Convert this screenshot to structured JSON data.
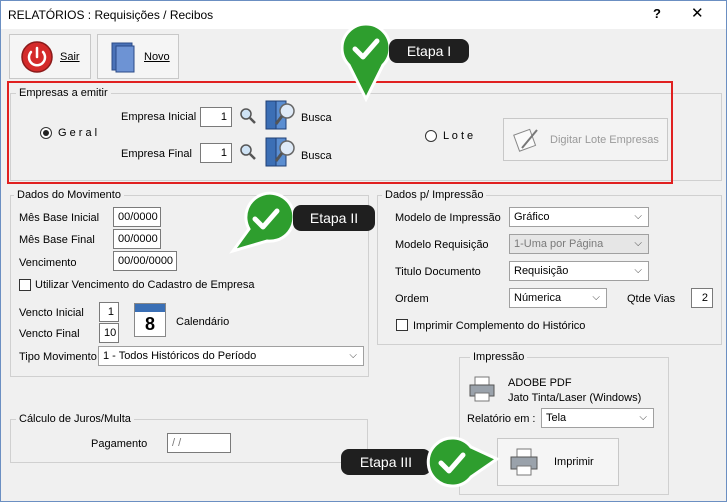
{
  "window": {
    "title": "RELATÓRIOS : Requisições / Recibos",
    "help": "?",
    "close": "✕"
  },
  "toolbar": {
    "sair": "Sair",
    "novo": "Novo"
  },
  "empresas": {
    "title": "Empresas a emitir",
    "geral": "G e r a l",
    "lote": "L o t e",
    "empresa_inicial_label": "Empresa Inicial",
    "empresa_inicial_value": "1",
    "empresa_final_label": "Empresa Final",
    "empresa_final_value": "1",
    "busca1": "Busca",
    "busca2": "Busca",
    "digitar_lote": "Digitar Lote Empresas"
  },
  "movimento": {
    "title": "Dados do Movimento",
    "mes_base_inicial_label": "Mês Base Inicial",
    "mes_base_inicial_value": "00/0000",
    "mes_base_final_label": "Mês Base Final",
    "mes_base_final_value": "00/0000",
    "vencimento_label": "Vencimento",
    "vencimento_value": "00/00/0000",
    "utilizar_label": "Utilizar Vencimento do Cadastro de Empresa",
    "vencto_inicial_label": "Vencto Inicial",
    "vencto_inicial_value": "1",
    "vencto_final_label": "Vencto Final",
    "vencto_final_value": "10",
    "calendario": "Calendário",
    "calendar_day": "8",
    "tipo_label": "Tipo Movimento",
    "tipo_value": "1 - Todos Históricos do Período"
  },
  "impressao_dados": {
    "title": "Dados p/ Impressão",
    "modelo_label": "Modelo de Impressão",
    "modelo_value": "Gráfico",
    "modelo_req_label": "Modelo Requisição",
    "modelo_req_value": "1-Uma  por Página",
    "titulo_label": "Titulo Documento",
    "titulo_value": "Requisição",
    "ordem_label": "Ordem",
    "ordem_value": "Númerica",
    "qtde_label": "Qtde Vias",
    "qtde_value": "2",
    "complemento_label": "Imprimir Complemento do Histórico"
  },
  "juros": {
    "title": "Cálculo de Juros/Multa",
    "pagamento_label": "Pagamento",
    "pagamento_value": " /  /"
  },
  "impressao": {
    "title": "Impressão",
    "printer_name": "ADOBE PDF",
    "printer_desc": "Jato Tinta/Laser (Windows)",
    "relatorio_label": "Relatório em :",
    "relatorio_value": "Tela",
    "imprimir": "Imprimir"
  },
  "callouts": {
    "etapa1": "Etapa I",
    "etapa2": "Etapa II",
    "etapa3": "Etapa III"
  },
  "colors": {
    "highlight": "#e02020",
    "callout_bg": "#1f1f1f",
    "check_green": "#2e9e2e"
  }
}
